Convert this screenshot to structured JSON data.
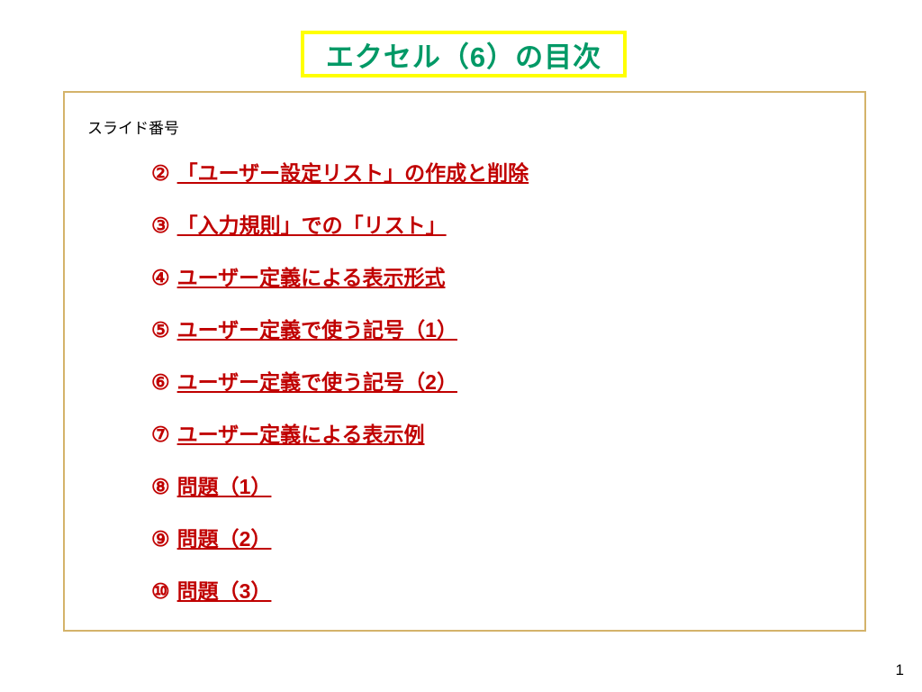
{
  "title": "エクセル（6）の目次",
  "slide_number_label": "スライド番号",
  "toc": [
    {
      "marker": "②",
      "label": "「ユーザー設定リスト」の作成と削除"
    },
    {
      "marker": "③",
      "label": "「入力規則」での「リスト」"
    },
    {
      "marker": "④",
      "label": "ユーザー定義による表示形式"
    },
    {
      "marker": "⑤",
      "label": "ユーザー定義で使う記号（1）"
    },
    {
      "marker": "⑥",
      "label": "ユーザー定義で使う記号（2）"
    },
    {
      "marker": "⑦",
      "label": "ユーザー定義による表示例"
    },
    {
      "marker": "⑧",
      "label": "問題（1）"
    },
    {
      "marker": "⑨",
      "label": "問題（2）"
    },
    {
      "marker": "⑩",
      "label": "問題（3）"
    }
  ],
  "page_number": "1"
}
